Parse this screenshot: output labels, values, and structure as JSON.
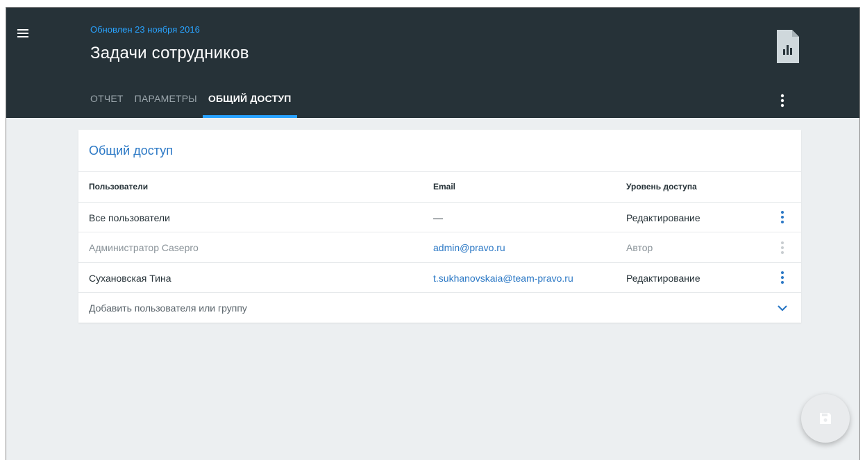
{
  "header": {
    "updated": "Обновлен 23 ноября 2016",
    "title": "Задачи сотрудников",
    "tabs": [
      {
        "label": "ОТЧЕТ"
      },
      {
        "label": "ПАРАМЕТРЫ"
      },
      {
        "label": "ОБЩИЙ ДОСТУП"
      }
    ],
    "active_tab": "ОБЩИЙ ДОСТУП",
    "icons": [
      "menu-icon",
      "report-document-icon",
      "more-vert-icon"
    ]
  },
  "sharing": {
    "title": "Общий доступ",
    "columns": [
      "Пользователи",
      "Email",
      "Уровень доступа"
    ],
    "rows": [
      {
        "user": "Все пользователи",
        "email": "—",
        "access": "Редактирование"
      },
      {
        "user": "Администратор Casepro",
        "email": "admin@pravo.ru",
        "access": "Автор"
      },
      {
        "user": "Сухановская Тина",
        "email": "t.sukhanovskaia@team-pravo.ru",
        "access": "Редактирование"
      }
    ],
    "add_placeholder": "Добавить пользователя или группу"
  },
  "fab": {
    "icon": "save-icon"
  },
  "colors": {
    "header_bg": "#263238",
    "accent": "#29a3ff",
    "link": "#2b78c5",
    "page_bg": "#eceff1"
  }
}
